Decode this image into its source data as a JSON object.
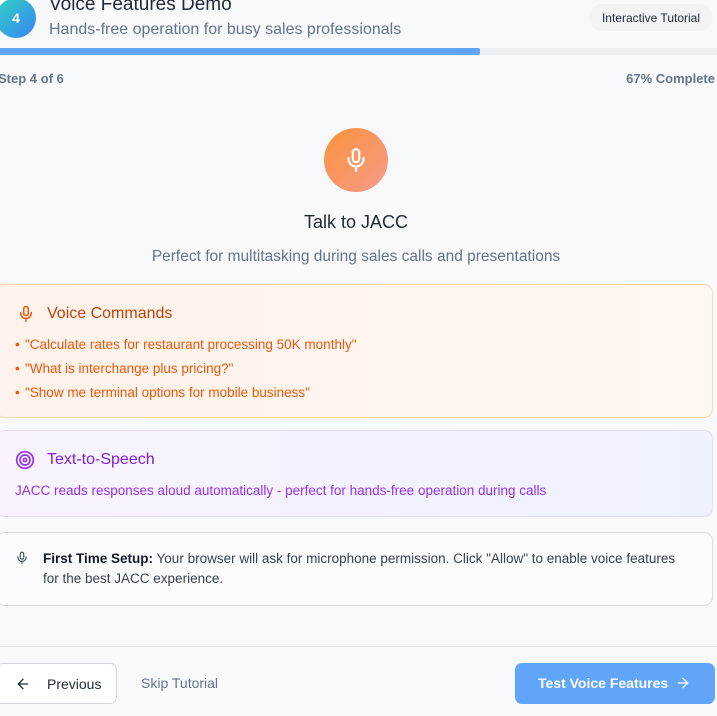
{
  "header": {
    "step_number": "4",
    "title": "Voice Features Demo",
    "subtitle": "Hands-free operation for busy sales professionals",
    "badge": "Interactive Tutorial",
    "progress_fraction": 0.67,
    "step_label": "Step 4 of 6",
    "percent_label": "67% Complete"
  },
  "hero": {
    "icon": "microphone-icon",
    "title": "Talk to JACC",
    "subtitle": "Perfect for multitasking during sales calls and presentations"
  },
  "voice_commands": {
    "icon": "microphone-icon",
    "title": "Voice Commands",
    "bullet": "•",
    "items": [
      "\"Calculate rates for restaurant processing 50K monthly\"",
      "\"What is interchange plus pricing?\"",
      "\"Show me terminal options for mobile business\""
    ]
  },
  "text_to_speech": {
    "icon": "target-icon",
    "title": "Text-to-Speech",
    "description": "JACC reads responses aloud automatically - perfect for hands-free operation during calls"
  },
  "setup_note": {
    "icon": "microphone-icon",
    "label": "First Time Setup:",
    "text": " Your browser will ask for microphone permission. Click \"Allow\" to enable voice features for the best JACC experience."
  },
  "footer": {
    "previous_label": "Previous",
    "skip_label": "Skip Tutorial",
    "test_label": "Test Voice Features"
  },
  "colors": {
    "accent_blue": "#60a5fa",
    "voice_orange": "#ea580c",
    "tts_purple": "#9333ea"
  }
}
